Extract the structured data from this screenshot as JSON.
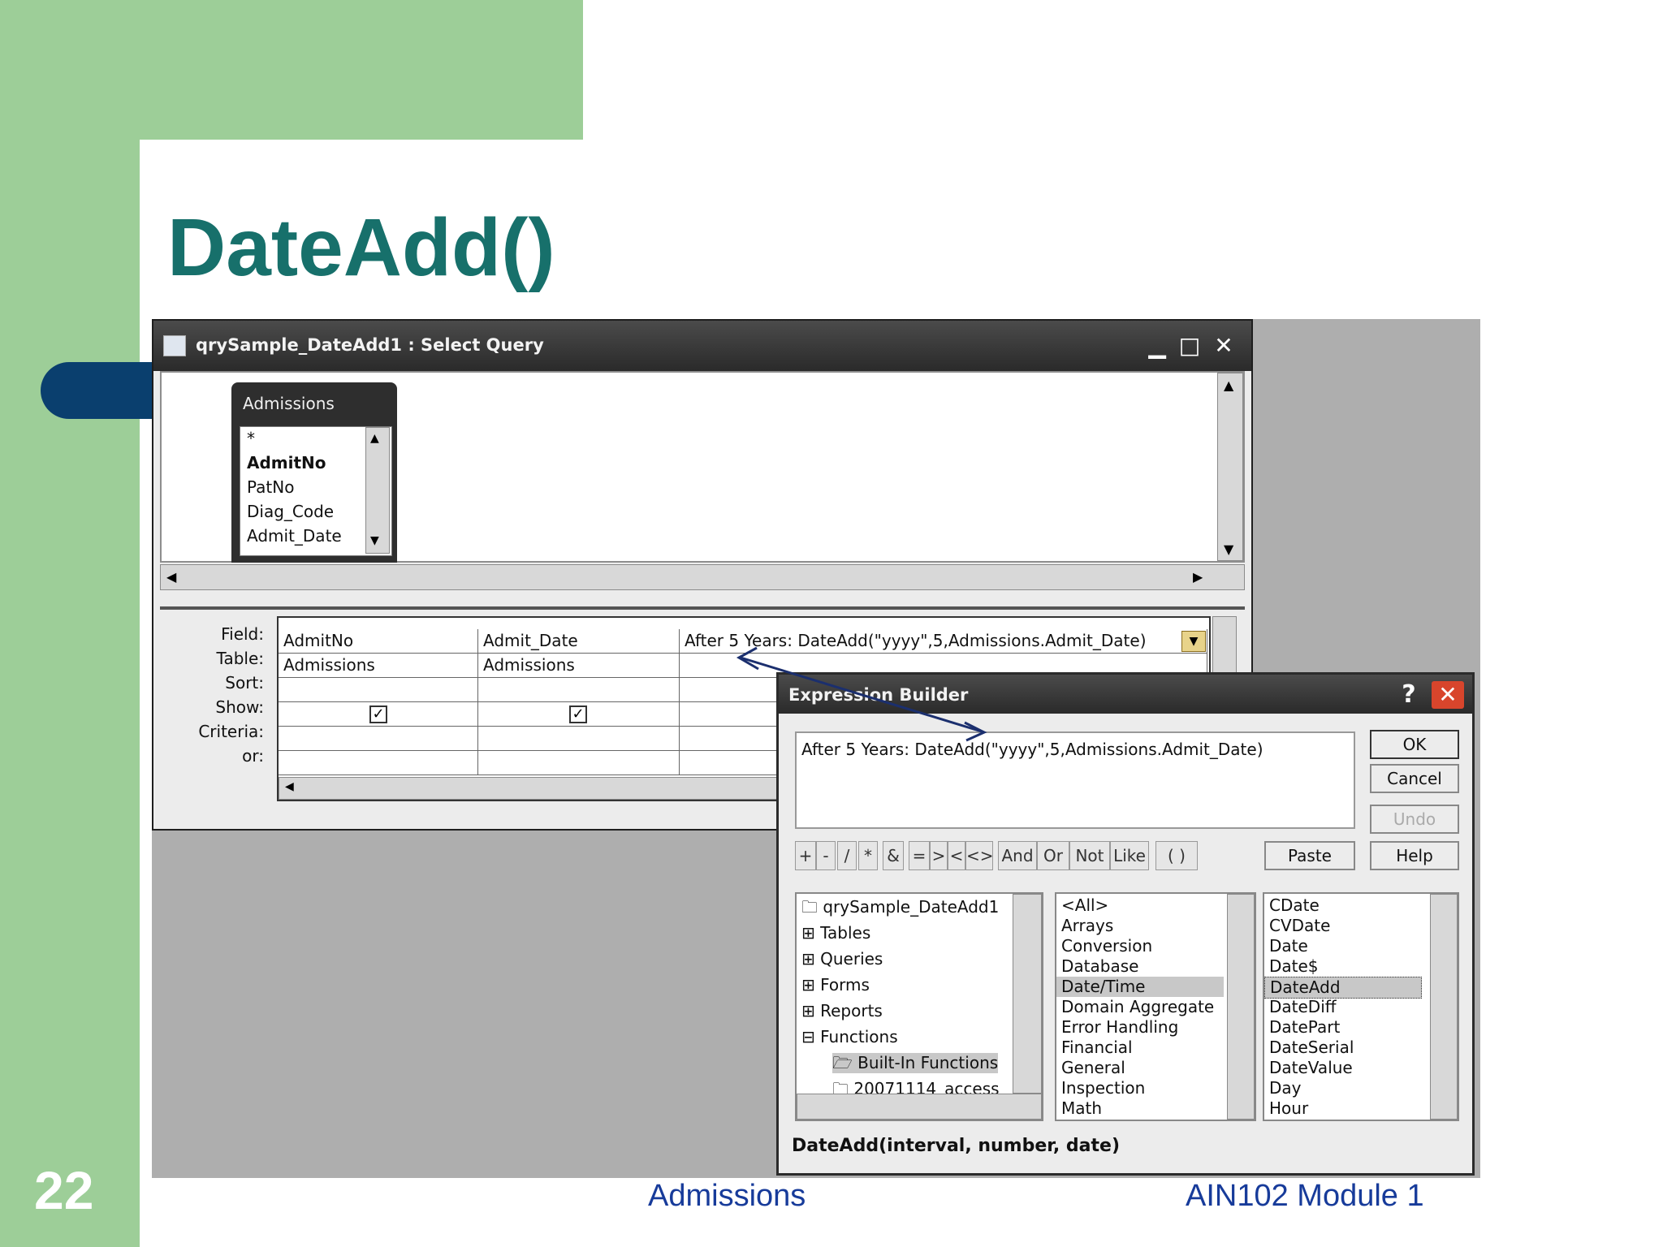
{
  "slide": {
    "title": "DateAdd()",
    "number": "22",
    "footer_center": "Admissions",
    "footer_right": "AIN102  Module 1"
  },
  "query_window": {
    "title": "qrySample_DateAdd1 : Select Query",
    "controls": {
      "minimize": "▁",
      "maximize": "□",
      "close": "✕"
    },
    "table": {
      "name": "Admissions",
      "fields": [
        "*",
        "AdmitNo",
        "PatNo",
        "Diag_Code",
        "Admit_Date"
      ]
    },
    "grid": {
      "row_labels": [
        "Field:",
        "Table:",
        "Sort:",
        "Show:",
        "Criteria:",
        "or:"
      ],
      "columns": [
        {
          "field": "AdmitNo",
          "table": "Admissions",
          "show": "✓"
        },
        {
          "field": "Admit_Date",
          "table": "Admissions",
          "show": "✓"
        },
        {
          "field": "After 5 Years: DateAdd(\"yyyy\",5,Admissions.Admit_Date)",
          "table": "",
          "show": ""
        }
      ]
    }
  },
  "expression_builder": {
    "title": "Expression Builder",
    "help": "?",
    "close": "✕",
    "expression": "After 5 Years: DateAdd(\"yyyy\",5,Admissions.Admit_Date)",
    "buttons": {
      "ok": "OK",
      "cancel": "Cancel",
      "undo": "Undo",
      "paste": "Paste",
      "help": "Help"
    },
    "operators": [
      "+",
      "-",
      "/",
      "*",
      "&",
      "=",
      ">",
      "<",
      "<>",
      "And",
      "Or",
      "Not",
      "Like",
      "( )"
    ],
    "tree": [
      "qrySample_DateAdd1",
      "Tables",
      "Queries",
      "Forms",
      "Reports",
      "Functions",
      "Built-In Functions",
      "20071114_access"
    ],
    "categories": [
      "<All>",
      "Arrays",
      "Conversion",
      "Database",
      "Date/Time",
      "Domain Aggregate",
      "Error Handling",
      "Financial",
      "General",
      "Inspection",
      "Math"
    ],
    "selected_category": "Date/Time",
    "functions": [
      "CDate",
      "CVDate",
      "Date",
      "Date$",
      "DateAdd",
      "DateDiff",
      "DatePart",
      "DateSerial",
      "DateValue",
      "Day",
      "Hour"
    ],
    "selected_function": "DateAdd",
    "syntax": "DateAdd(interval, number, date)"
  },
  "colors": {
    "accent_green": "#9dce98",
    "title_teal": "#17706b",
    "navy": "#0a3f6e",
    "footer_blue": "#173b9a"
  }
}
